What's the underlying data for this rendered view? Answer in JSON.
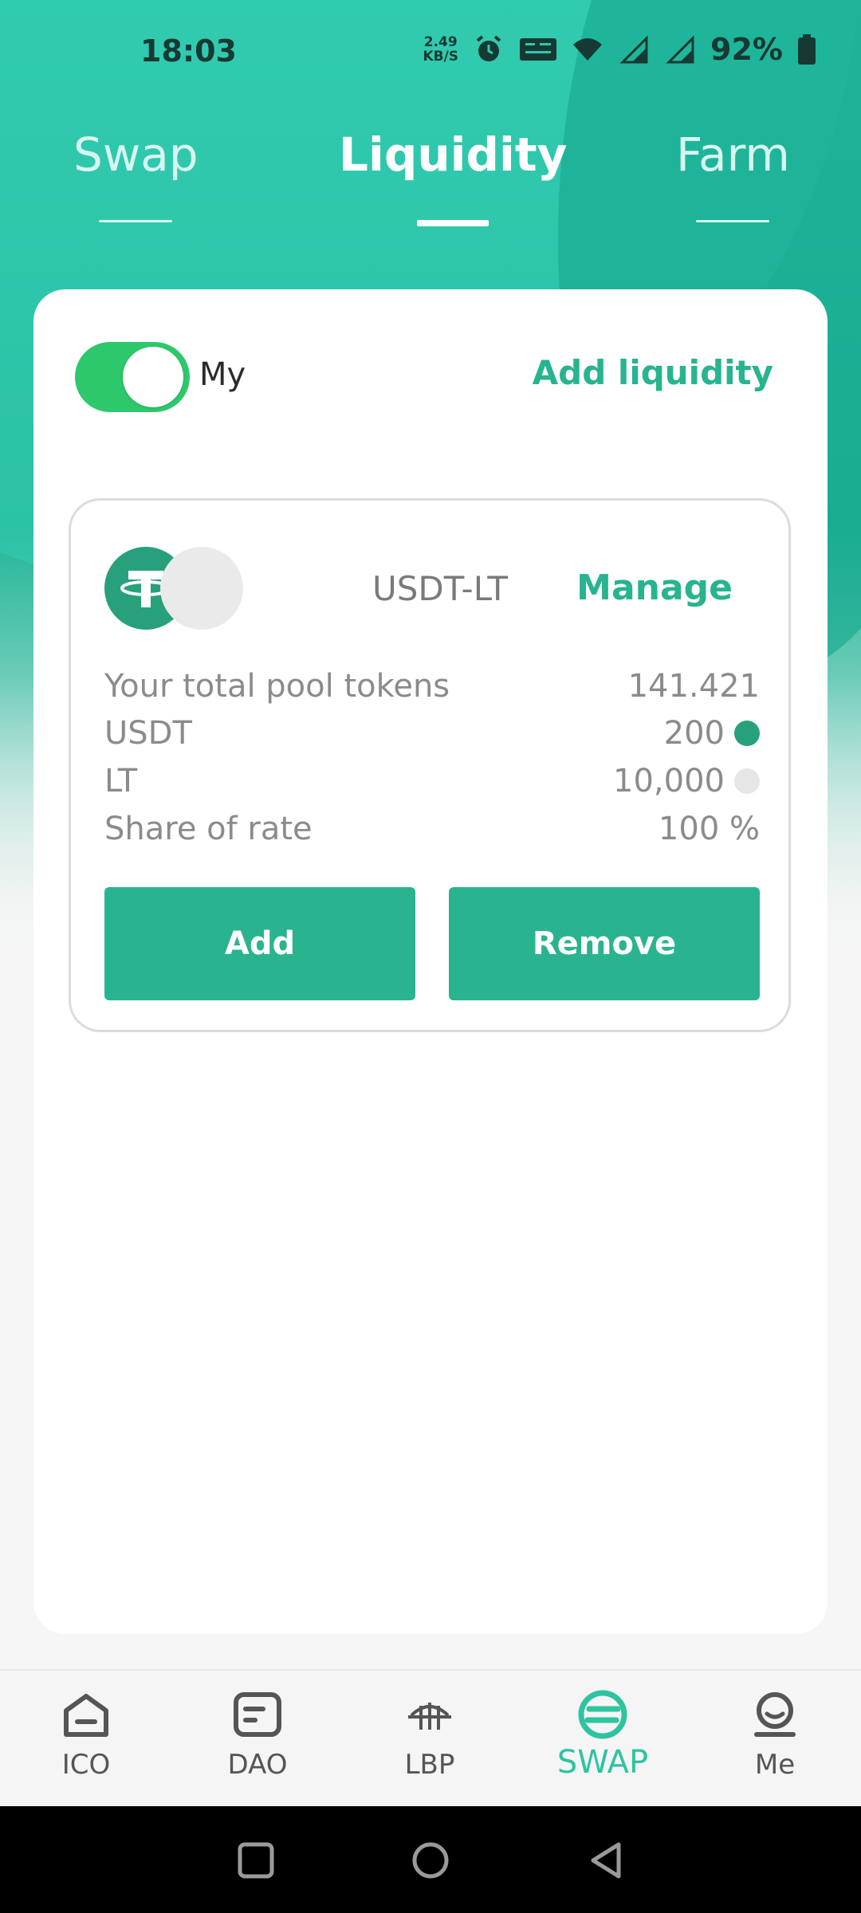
{
  "status_bar": {
    "time": "18:03",
    "net_speed_value": "2.49",
    "net_speed_unit": "KB/S",
    "icons": [
      "alarm-icon",
      "volte-icon",
      "wifi-icon",
      "signal-4g-icon",
      "signal-4g-icon",
      "battery-icon"
    ],
    "battery": "92%"
  },
  "tabs": [
    {
      "label": "Swap",
      "active": false
    },
    {
      "label": "Liquidity",
      "active": true
    },
    {
      "label": "Farm",
      "active": false
    }
  ],
  "liquidity": {
    "toggle_label": "My",
    "toggle_on": true,
    "add_liquidity_label": "Add liquidity",
    "pool": {
      "pair": "USDT-LT",
      "manage_label": "Manage",
      "rows": [
        {
          "label": "Your total pool tokens",
          "value": "141.421"
        },
        {
          "label": "USDT",
          "value": "200",
          "icon": "usdt-coin-icon"
        },
        {
          "label": "LT",
          "value": "10,000",
          "icon": "lt-coin-icon"
        },
        {
          "label": "Share of rate",
          "value": "100 %"
        }
      ],
      "add_button": "Add",
      "remove_button": "Remove"
    }
  },
  "bottom_nav": [
    {
      "label": "ICO",
      "icon": "home-icon",
      "active": false
    },
    {
      "label": "DAO",
      "icon": "document-icon",
      "active": false
    },
    {
      "label": "LBP",
      "icon": "bridge-icon",
      "active": false
    },
    {
      "label": "SWAP",
      "icon": "swap-icon",
      "active": true
    },
    {
      "label": "Me",
      "icon": "profile-icon",
      "active": false
    }
  ],
  "colors": {
    "brand": "#2ab38f",
    "accent_text": "#27b48f",
    "toggle_on": "#2ec86c",
    "usdt": "#26a17b"
  }
}
